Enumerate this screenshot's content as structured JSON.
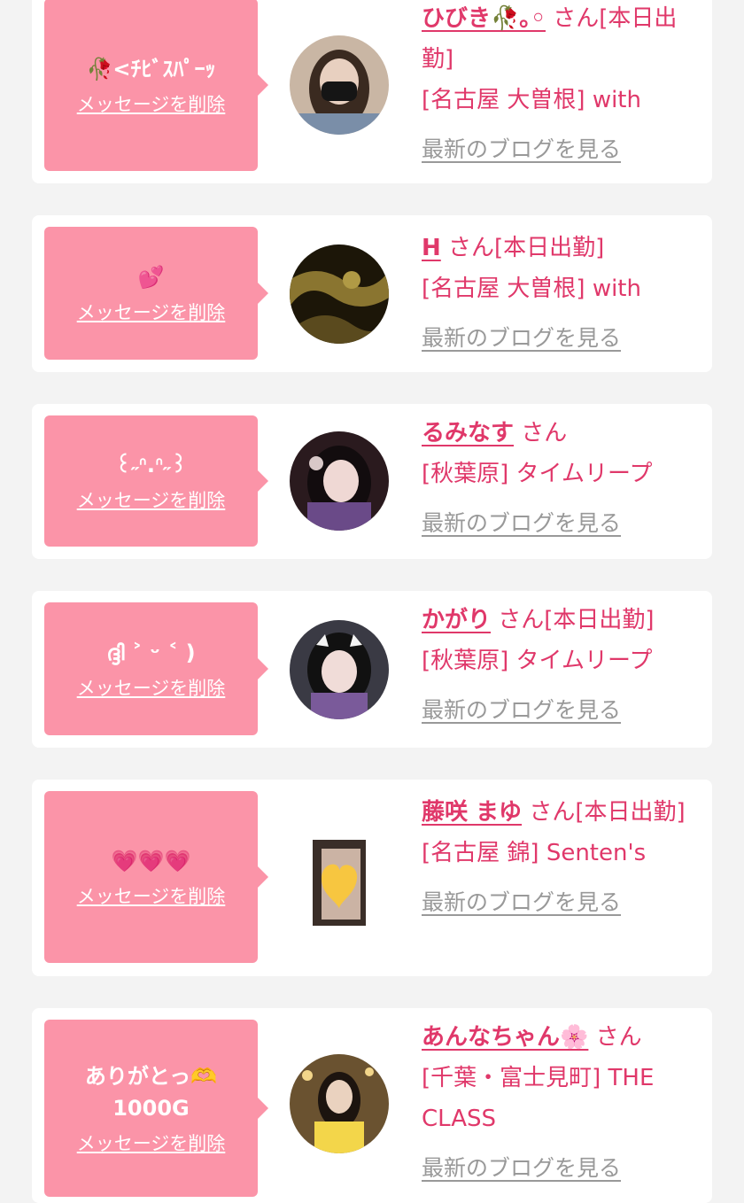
{
  "delete_label": "メッセージを削除",
  "blog_label": "最新のブログを見る",
  "colors": {
    "background": "#f3f3f3",
    "bubble": "#fb94a8",
    "accent": "#e0386a",
    "link_gray": "#999999"
  },
  "cards": [
    {
      "message": "🥀<ﾁﾋﾞｽﾊﾟｰｯ",
      "name": "ひびき🥀｡◦",
      "suffix": "さん[本日出勤]",
      "shop": "[名古屋 大曽根] with"
    },
    {
      "message": "💕",
      "name": "H",
      "suffix": "さん[本日出勤]",
      "shop": "[名古屋 大曽根] with"
    },
    {
      "message": "꒰˶ᐢ.ᐢ˶꒱",
      "name": "るみなす",
      "suffix": "さん",
      "shop": "[秋葉原] タイムリープ"
    },
    {
      "message": "ദ്ദി ˃ ᵕ ˂ )",
      "name": "かがり",
      "suffix": "さん[本日出勤]",
      "shop": "[秋葉原] タイムリープ"
    },
    {
      "message": "💗💗💗",
      "name": "藤咲 まゆ",
      "suffix": "さん[本日出勤]",
      "shop": "[名古屋 錦] Senten's"
    },
    {
      "message": "ありがとっ🫶\n1000G",
      "name": "あんなちゃん🌸",
      "suffix": "さん",
      "shop": "[千葉・富士見町] THE CLASS"
    }
  ]
}
